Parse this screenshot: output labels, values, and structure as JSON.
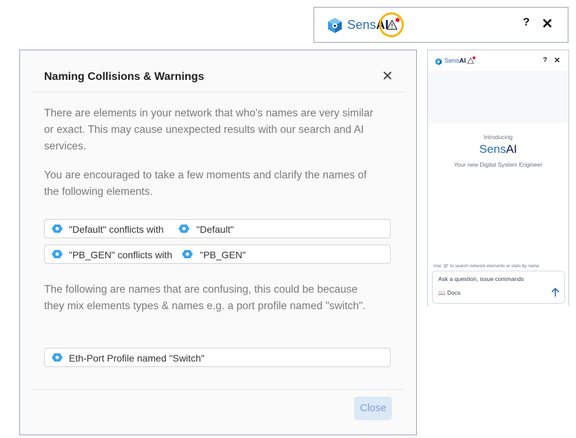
{
  "colors": {
    "brand_blue": "#2b6cb0",
    "brand_navy": "#0d1b4a",
    "alert_red": "#e11d2e",
    "highlight_ring": "#f5b400"
  },
  "top_header": {
    "brand_light": "Sens",
    "brand_bold": "AI",
    "warning_icon": "warning-triangle-icon",
    "help_label": "?",
    "close_label": "✕"
  },
  "dialog": {
    "title": "Naming Collisions & Warnings",
    "close_x": "✕",
    "paragraph1": "There are elements in your network that who's names are very similar or exact. This may cause unexpected results with our search and AI services.",
    "paragraph2": "You are encouraged to take a few moments and clarify the names of the following elements.",
    "conflicts": [
      {
        "name": "\"Default\" conflicts with",
        "target": "\"Default\""
      },
      {
        "name": "\"PB_GEN\" conflicts with",
        "target": "\"PB_GEN\""
      }
    ],
    "paragraph3": "The following are names that are confusing, this could be because they mix elements types & names e.g. a port profile named \"switch\".",
    "confusing": [
      {
        "label": "Eth-Port Profile named \"Switch\""
      }
    ],
    "close_button": "Close"
  },
  "side_panel": {
    "brand_light": "Sens",
    "brand_bold": "AI",
    "help_label": "?",
    "close_label": "✕",
    "introducing": "Introducing",
    "tagline": "Your new Digital System Engineer",
    "hint": "Use '@' to search network elements or stats by name",
    "ask_placeholder": "Ask a question, issue commands",
    "docs_label": "Docs"
  }
}
